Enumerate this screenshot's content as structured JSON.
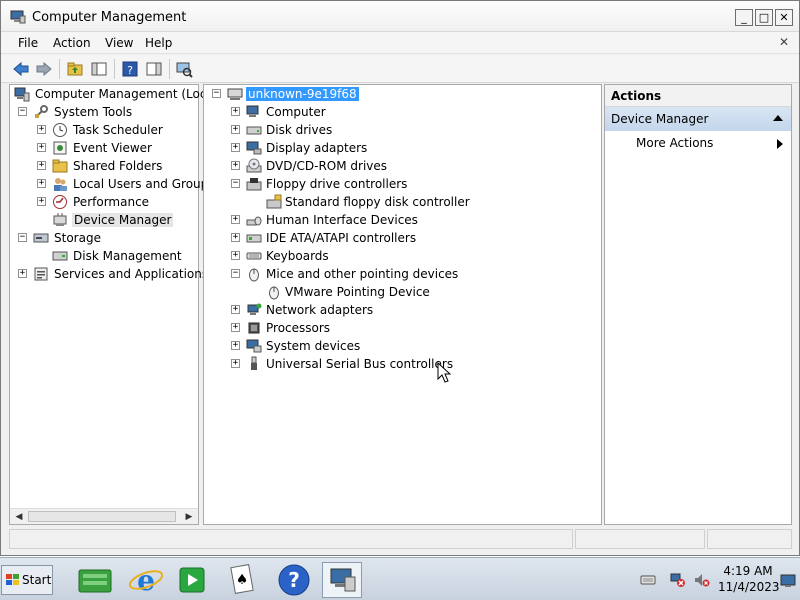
{
  "window": {
    "title": "Computer Management",
    "menu": [
      "File",
      "Action",
      "View",
      "Help"
    ]
  },
  "left_tree": {
    "root": "Computer Management (Local",
    "system_tools": "System Tools",
    "task_scheduler": "Task Scheduler",
    "event_viewer": "Event Viewer",
    "shared_folders": "Shared Folders",
    "local_users": "Local Users and Groups",
    "performance": "Performance",
    "device_manager": "Device Manager",
    "storage": "Storage",
    "disk_management": "Disk Management",
    "services": "Services and Applications"
  },
  "device_tree": {
    "root": "unknown-9e19f68",
    "computer": "Computer",
    "disk_drives": "Disk drives",
    "display_adapters": "Display adapters",
    "dvd": "DVD/CD-ROM drives",
    "floppy_controllers": "Floppy drive controllers",
    "floppy_child": "Standard floppy disk controller",
    "hid": "Human Interface Devices",
    "ide": "IDE ATA/ATAPI controllers",
    "keyboards": "Keyboards",
    "mice": "Mice and other pointing devices",
    "mice_child": "VMware Pointing Device",
    "network": "Network adapters",
    "processors": "Processors",
    "system_devices": "System devices",
    "usb": "Universal Serial Bus controllers"
  },
  "actions": {
    "header": "Actions",
    "section": "Device Manager",
    "more": "More Actions"
  },
  "taskbar": {
    "start": "Start",
    "time": "4:19 AM",
    "date": "11/4/2023"
  },
  "colors": {
    "selection": "#3399ff",
    "actions_section": "#c3d6ec"
  }
}
